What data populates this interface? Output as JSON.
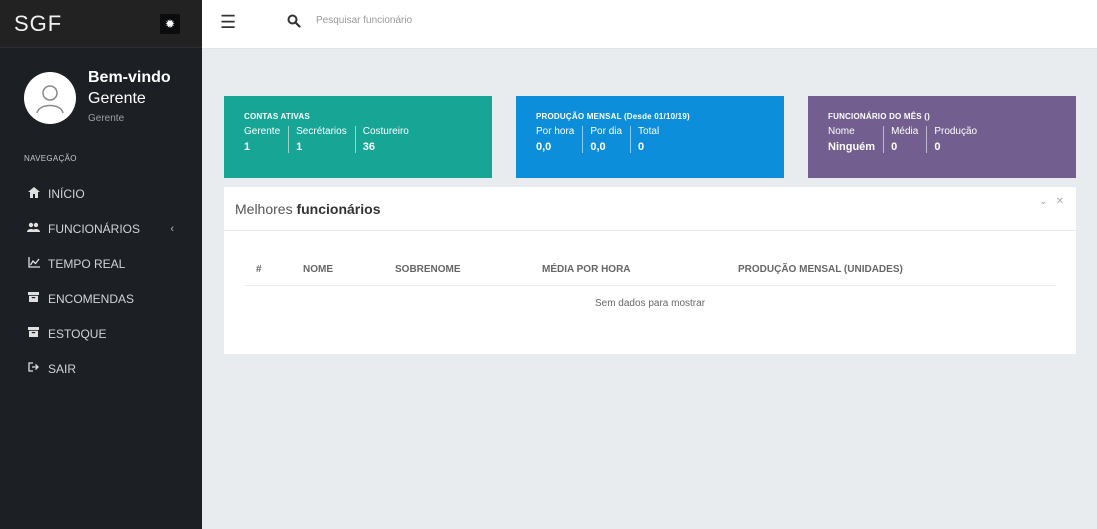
{
  "app": {
    "title": "SGF"
  },
  "profile": {
    "welcome": "Bem-vindo",
    "name": "Gerente",
    "role": "Gerente"
  },
  "nav": {
    "heading": "NAVEGAÇÃO",
    "items": [
      {
        "label": "INÍCIO",
        "icon": "home-icon"
      },
      {
        "label": "FUNCIONÁRIOS",
        "icon": "users-icon"
      },
      {
        "label": "TEMPO REAL",
        "icon": "line-chart-icon"
      },
      {
        "label": "ENCOMENDAS",
        "icon": "box-icon"
      },
      {
        "label": "ESTOQUE",
        "icon": "box-icon"
      },
      {
        "label": "SAIR",
        "icon": "sign-out-icon"
      }
    ]
  },
  "search": {
    "placeholder": "Pesquisar funcionário"
  },
  "cards": [
    {
      "title": "CONTAS ATIVAS",
      "color": "#17a596",
      "cols": [
        {
          "label": "Gerente",
          "value": "1"
        },
        {
          "label": "Secrétarios",
          "value": "1"
        },
        {
          "label": "Costureiro",
          "value": "36"
        }
      ]
    },
    {
      "title": "PRODUÇÃO MENSAL (Desde 01/10/19)",
      "color": "#0d8edb",
      "cols": [
        {
          "label": "Por hora",
          "value": "0,0"
        },
        {
          "label": "Por dia",
          "value": "0,0"
        },
        {
          "label": "Total",
          "value": "0"
        }
      ]
    },
    {
      "title": "FUNCIONÁRIO DO MÊS ()",
      "color": "#725f8f",
      "cols": [
        {
          "label": "Nome",
          "value": "Ninguém"
        },
        {
          "label": "Média",
          "value": "0"
        },
        {
          "label": "Produção",
          "value": "0"
        }
      ]
    }
  ],
  "panel": {
    "title_plain": "Melhores ",
    "title_bold": "funcionários",
    "columns": [
      "#",
      "NOME",
      "SOBRENOME",
      "MÉDIA POR HORA",
      "PRODUÇÃO MENSAL (UNIDADES)"
    ],
    "empty_text": "Sem dados para mostrar"
  }
}
